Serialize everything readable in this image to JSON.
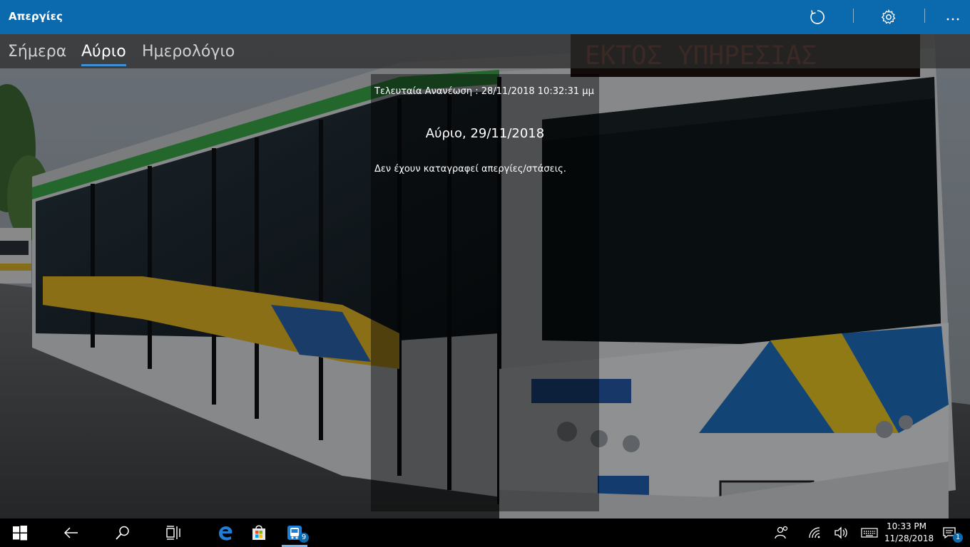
{
  "app": {
    "title": "Απεργίες"
  },
  "titlebar": {
    "refresh_icon": "refresh-icon",
    "settings_icon": "gear-icon",
    "more_icon": "more-icon"
  },
  "tabs": [
    {
      "label": "Σήμερα",
      "active": false
    },
    {
      "label": "Αύριο",
      "active": true
    },
    {
      "label": "Ημερολόγιο",
      "active": false
    }
  ],
  "panel": {
    "last_refresh": "Τελευταία Ανανέωση : 28/11/2018 10:32:31 μμ",
    "day_title": "Αύριο, 29/11/2018",
    "message": "Δεν έχουν καταγραφεί απεργίες/στάσεις."
  },
  "taskbar": {
    "app_badge": "9",
    "time": "10:33 PM",
    "date": "11/28/2018",
    "notification_count": "1"
  },
  "colors": {
    "accent": "#0b6aad",
    "tab_underline": "#3d8fd6"
  }
}
